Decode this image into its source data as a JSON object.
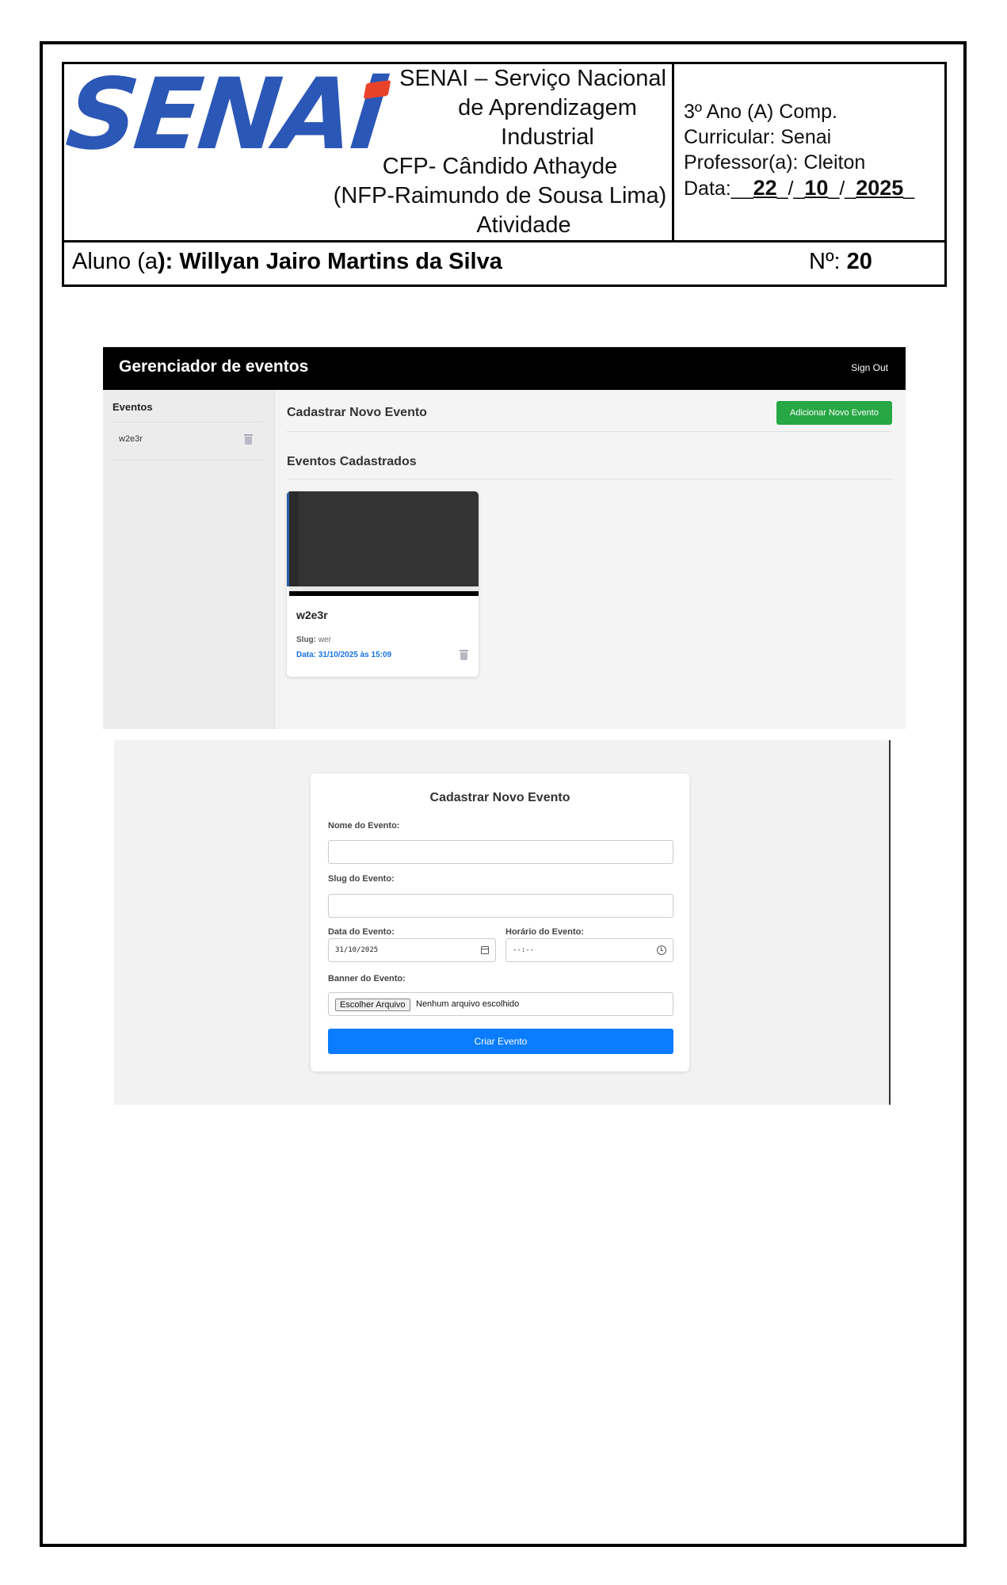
{
  "header": {
    "logo_text": "SENAi",
    "institution": {
      "line1": "SENAI – Serviço Nacional",
      "line2": "de Aprendizagem",
      "line3": "Industrial",
      "line4": "CFP- Cândido Athayde",
      "line5": "(NFP-Raimundo de Sousa Lima)",
      "line6": "Atividade"
    },
    "info": {
      "turma": "3º Ano (A) Comp.",
      "curricular": "Curricular: Senai",
      "professor": "Professor(a): Cleiton",
      "data_label": "Data:",
      "day": "22",
      "month": "10",
      "year": "2025"
    },
    "aluno_label": "Aluno (a",
    "aluno_name": "): Willyan Jairo Martins da Silva",
    "numero_label": "Nº:",
    "numero_value": "20"
  },
  "app": {
    "title": "Gerenciador de eventos",
    "signout": "Sign Out",
    "sidebar_title": "Eventos",
    "sidebar_items": [
      {
        "label": "w2e3r"
      }
    ],
    "register_heading": "Cadastrar Novo Evento",
    "add_button": "Adicionar Novo Evento",
    "list_heading": "Eventos Cadastrados",
    "events": [
      {
        "title": "w2e3r",
        "slug_label": "Slug:",
        "slug": "wer",
        "date": "Data: 31/10/2025 às 15:09"
      }
    ]
  },
  "form": {
    "title": "Cadastrar Novo Evento",
    "name_label": "Nome do Evento:",
    "slug_label": "Slug do Evento:",
    "date_label": "Data do Evento:",
    "date_value": "31/10/2025",
    "time_label": "Horário do Evento:",
    "time_value": "--:--",
    "banner_label": "Banner do Evento:",
    "file_button": "Escolher Arquivo",
    "file_status": "Nenhum arquivo escolhido",
    "submit": "Criar Evento"
  },
  "colors": {
    "logo_blue": "#2b57b6",
    "logo_red": "#e8432a",
    "add_green": "#28a745",
    "submit_blue": "#0a7cff",
    "date_blue": "#1a73e8"
  }
}
